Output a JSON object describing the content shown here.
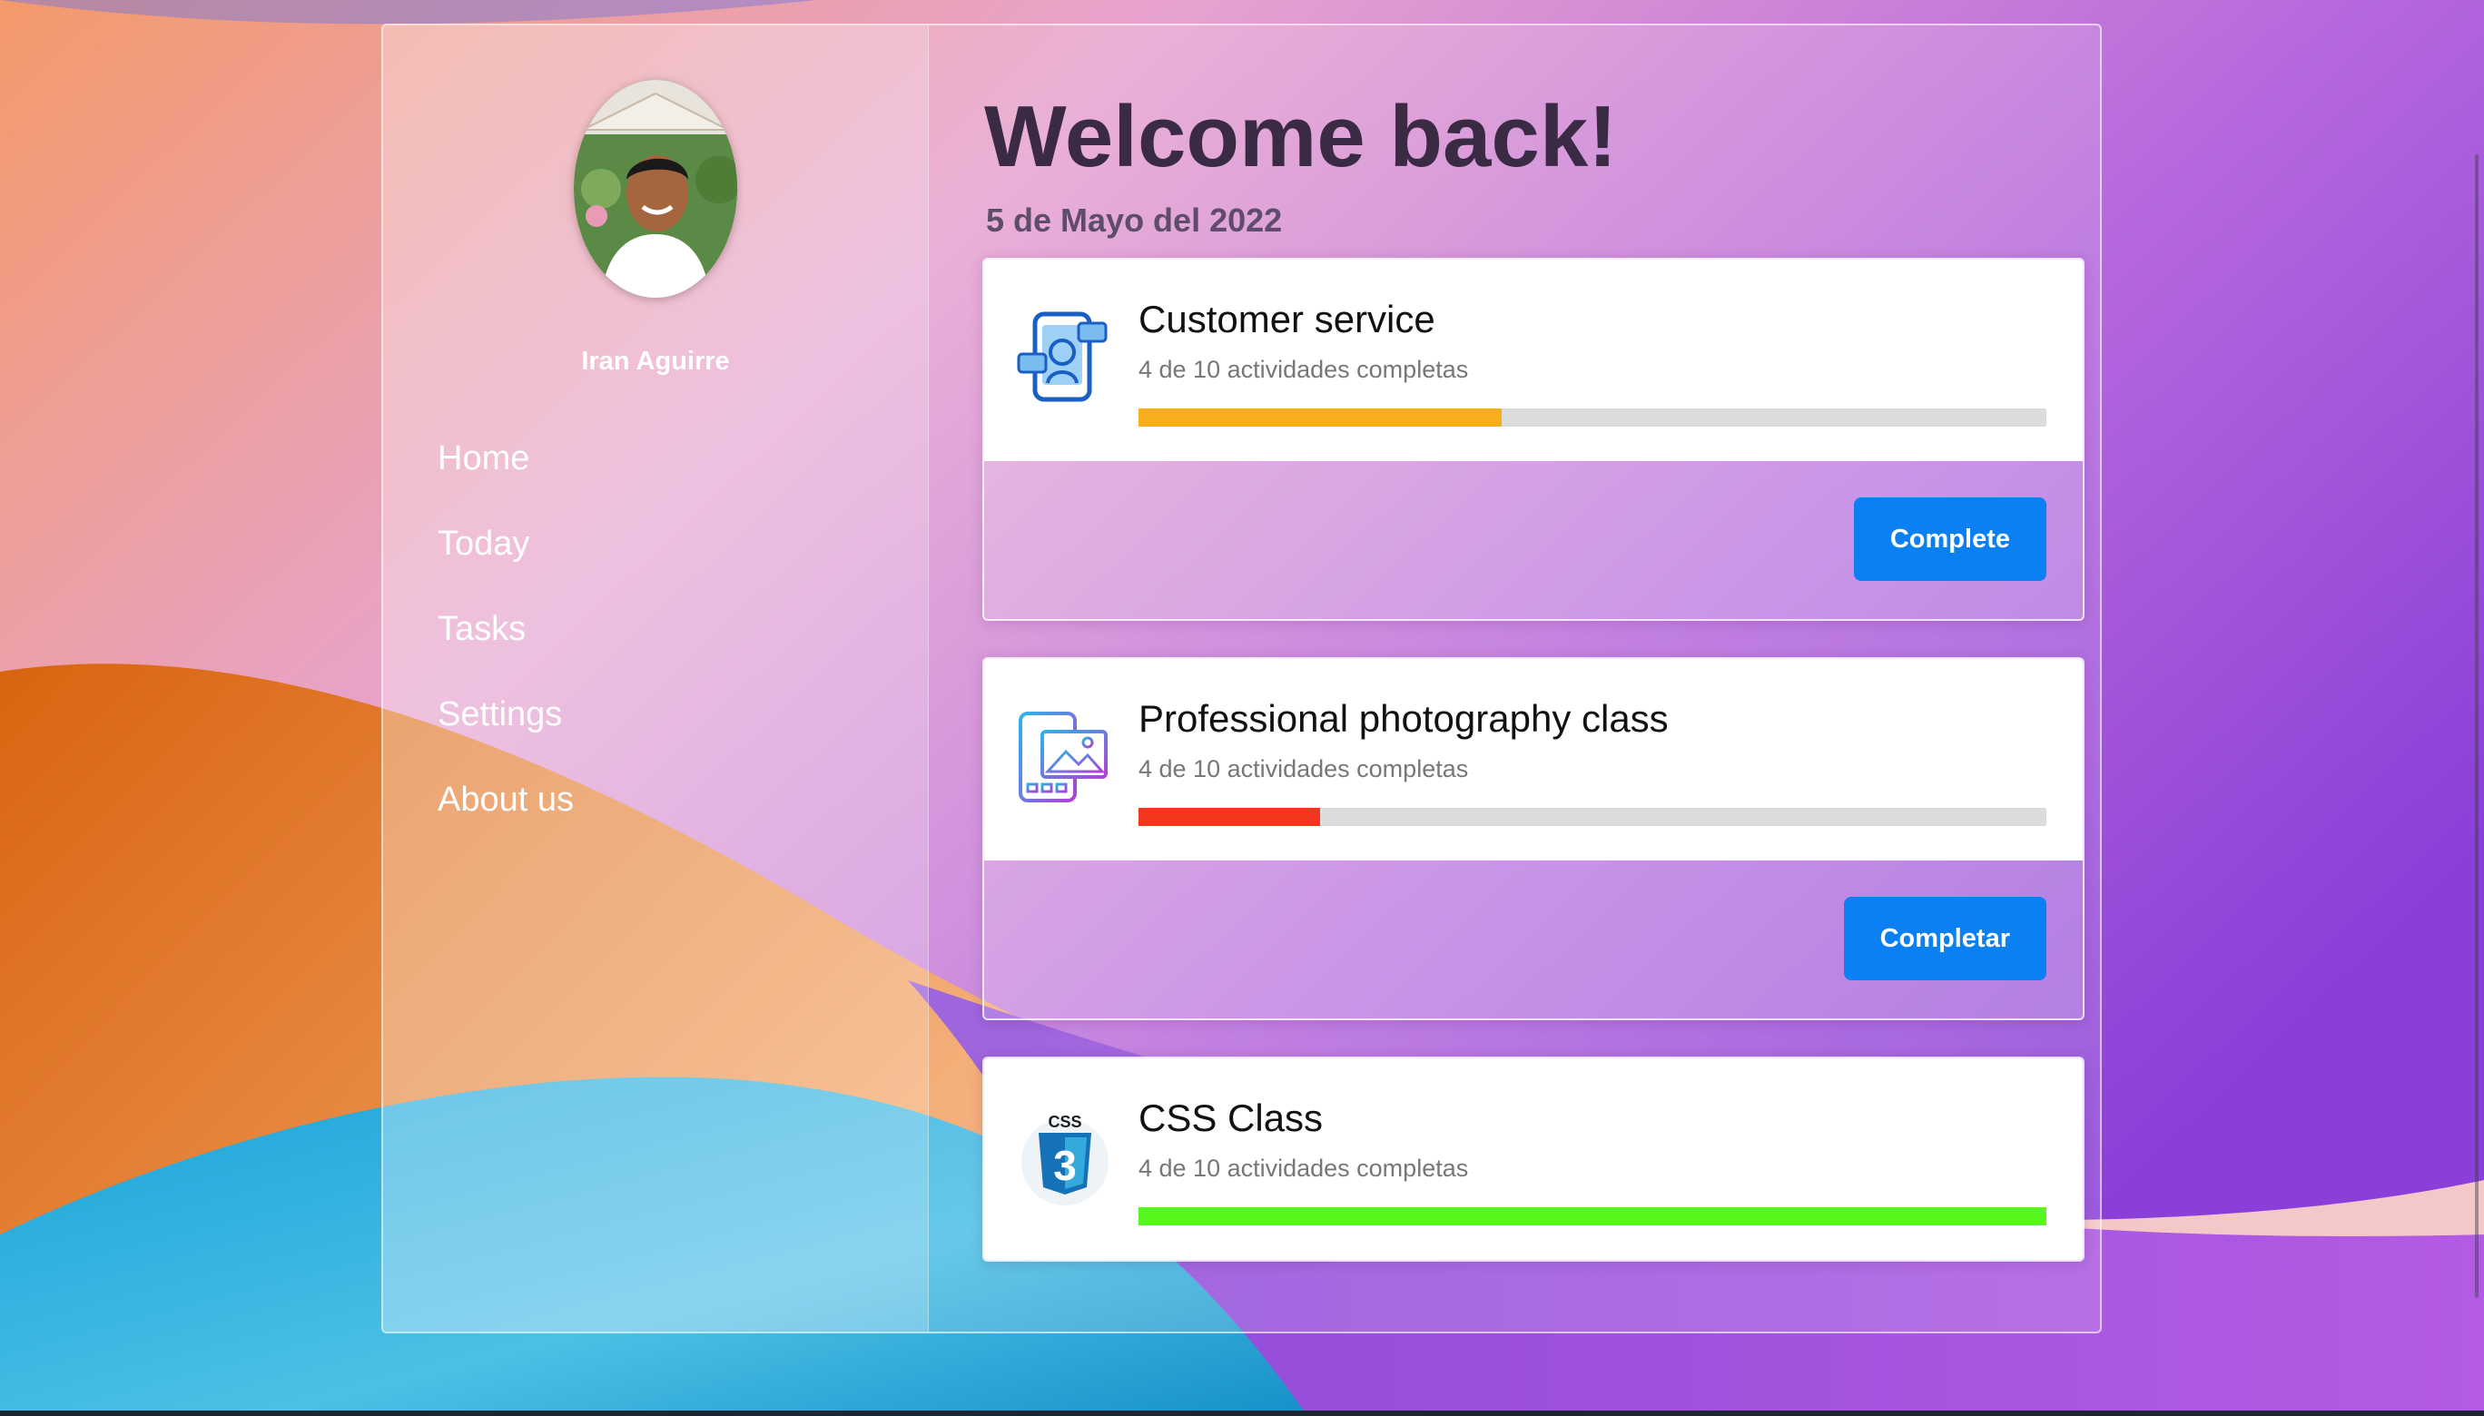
{
  "user": {
    "name": "Iran Aguirre"
  },
  "nav": [
    {
      "label": "Home"
    },
    {
      "label": "Today"
    },
    {
      "label": "Tasks"
    },
    {
      "label": "Settings"
    },
    {
      "label": "About us"
    }
  ],
  "main": {
    "title": "Welcome back!",
    "date": "5 de Mayo del 2022"
  },
  "cards": [
    {
      "title": "Customer service",
      "subtitle": "4 de 10 actividades completas",
      "progress": 0.4,
      "progress_color": "#f7b01c",
      "button_label": "Complete",
      "icon": "customer-service-icon"
    },
    {
      "title": "Professional photography class",
      "subtitle": "4 de 10 actividades completas",
      "progress": 0.2,
      "progress_color": "#f3361e",
      "button_label": "Completar",
      "icon": "photography-icon"
    },
    {
      "title": "CSS Class",
      "subtitle": "4 de 10 actividades completas",
      "progress": 1.0,
      "progress_color": "#57f61c",
      "button_label": "",
      "icon": "css3-icon"
    }
  ],
  "colors": {
    "button": "#0a80f2",
    "title": "#3a2a44",
    "track": "#dcdcdc"
  }
}
